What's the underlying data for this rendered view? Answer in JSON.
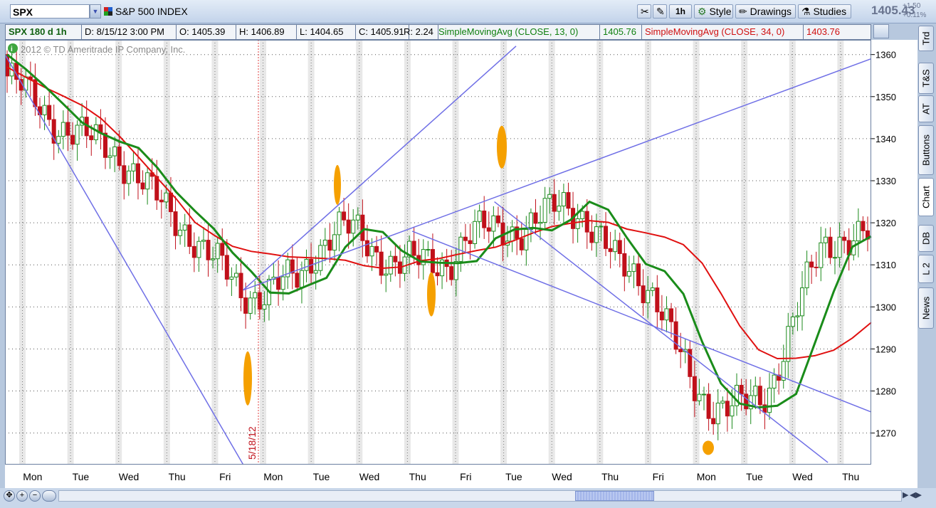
{
  "toolbar": {
    "symbol": "SPX",
    "description": "S&P 500 INDEX",
    "aggregation": "1h",
    "style_label": "Style",
    "drawings_label": "Drawings",
    "studies_label": "Studies",
    "last_price": "1405.43",
    "change": "+1.50",
    "change_pct": "+0.11%"
  },
  "info_bar": {
    "title": "SPX 180 d 1h",
    "date": "D: 8/15/12 3:00 PM",
    "open": "O: 1405.39",
    "high": "H: 1406.89",
    "low": "L: 1404.65",
    "close": "C: 1405.91",
    "range": "R: 2.24",
    "sma13_label": "SimpleMovingAvg (CLOSE, 13, 0)",
    "sma13_value": "1405.76",
    "sma34_label": "SimpleMovingAvg (CLOSE, 34, 0)",
    "sma34_value": "1403.76"
  },
  "copyright": "2012 © TD Ameritrade IP Company, Inc.",
  "side_tabs": [
    "Trd",
    "T&S",
    "AT",
    "Buttons",
    "Chart",
    "DB",
    "L 2",
    "News"
  ],
  "colors": {
    "up": "#1c8a1c",
    "down": "#c0101a",
    "sma13": "#1a8c1a",
    "sma34": "#e01010",
    "trendline": "#6f6fe6",
    "marker": "#f5a000"
  },
  "chart_data": {
    "type": "candlestick",
    "ylim": [
      1262.5,
      1363.5
    ],
    "y_ticks": [
      1270,
      1280,
      1290,
      1300,
      1310,
      1320,
      1330,
      1340,
      1350,
      1360
    ],
    "x_labels": [
      "Mon",
      "Tue",
      "Wed",
      "Thu",
      "Fri",
      "Mon",
      "Tue",
      "Wed",
      "Thu",
      "Fri",
      "Tue",
      "Wed",
      "Thu",
      "Fri",
      "Mon",
      "Tue",
      "Wed",
      "Thu"
    ],
    "date_annotation": "5/18/12",
    "series": [
      {
        "name": "SimpleMovingAvg (CLOSE, 13, 0)",
        "color": "#1a8c1a",
        "values": [
          1360.0,
          1356.5,
          1352.5,
          1348.2,
          1343.8,
          1341.3,
          1339.3,
          1337.8,
          1333.1,
          1327.3,
          1322.8,
          1318.6,
          1312.9,
          1308.4,
          1303.4,
          1303.2,
          1305.1,
          1306.9,
          1314.2,
          1318.5,
          1317.8,
          1313.4,
          1310.8,
          1310.5,
          1310.4,
          1310.9,
          1316.3,
          1318.4,
          1318.8,
          1318.2,
          1320.7,
          1325.0,
          1323.1,
          1316.4,
          1310.2,
          1308.5,
          1303.1,
          1291.7,
          1281.8,
          1277.0,
          1276.1,
          1276.5,
          1279.3,
          1291.4,
          1303.6,
          1314.3,
          1316.8
        ]
      },
      {
        "name": "SimpleMovingAvg (CLOSE, 34, 0)",
        "color": "#e01010",
        "values": [
          1357.0,
          1354.6,
          1352.2,
          1350.1,
          1347.9,
          1344.8,
          1340.5,
          1335.6,
          1330.6,
          1325.7,
          1320.1,
          1317.1,
          1314.4,
          1313.2,
          1312.6,
          1311.9,
          1311.7,
          1311.5,
          1311.1,
          1309.8,
          1309.2,
          1309.5,
          1311.0,
          1311.5,
          1312.5,
          1313.4,
          1314.2,
          1315.8,
          1317.6,
          1319.1,
          1319.9,
          1320.5,
          1320.1,
          1318.5,
          1317.6,
          1316.6,
          1314.8,
          1310.4,
          1303.2,
          1295.5,
          1289.8,
          1287.7,
          1287.8,
          1288.4,
          1289.7,
          1292.6,
          1296.3
        ]
      }
    ],
    "series_points": 47,
    "candles_summary": {
      "start": 1360,
      "low": 1266,
      "low_label_day": "Mon",
      "end": 1316
    },
    "trendlines": [
      {
        "from": [
          0,
          1360
        ],
        "to": [
          55,
          1262.5
        ]
      },
      {
        "from": [
          55,
          1304
        ],
        "to": [
          118,
          1362
        ]
      },
      {
        "from": [
          55,
          1304
        ],
        "to": [
          200,
          1359
        ]
      },
      {
        "from": [
          94,
          1318
        ],
        "to": [
          200,
          1275
        ]
      },
      {
        "from": [
          113,
          1325
        ],
        "to": [
          190,
          1263
        ]
      }
    ],
    "markers_count": 6
  }
}
